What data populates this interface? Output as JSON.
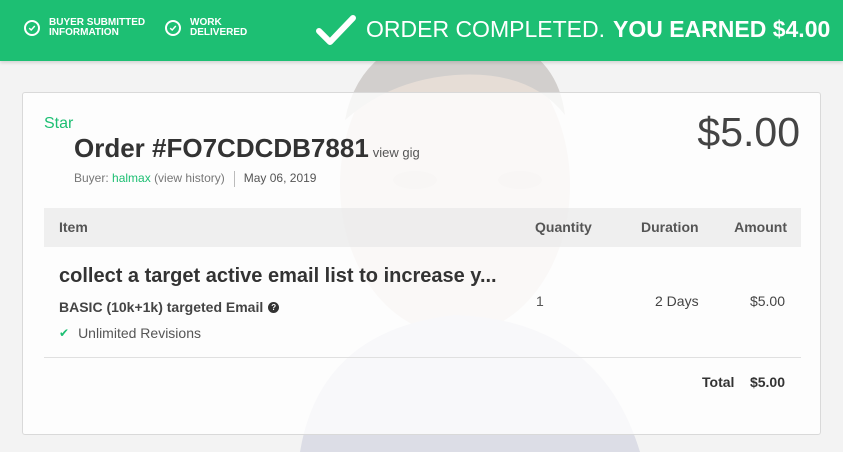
{
  "header": {
    "steps": [
      {
        "line1": "BUYER SUBMITTED",
        "line2": "INFORMATION"
      },
      {
        "line1": "WORK",
        "line2": "DELIVERED"
      }
    ],
    "status_text": "ORDER COMPLETED.",
    "earned_text": "YOU EARNED $4.00"
  },
  "order": {
    "gig_title": "Star",
    "number": "Order #FO7CDCDB7881",
    "view_gig": "view gig",
    "buyer_prefix": "Buyer: ",
    "buyer_name": "halmax",
    "view_history": "(view history)",
    "date": "May 06, 2019",
    "price": "$5.00"
  },
  "table": {
    "headers": {
      "item": "Item",
      "quantity": "Quantity",
      "duration": "Duration",
      "amount": "Amount"
    },
    "row": {
      "title": "collect a target active email list to increase y...",
      "package": "BASIC (10k+1k) targeted Email",
      "feature": "Unlimited Revisions",
      "quantity": "1",
      "duration": "2 Days",
      "amount": "$5.00"
    },
    "total_label": "Total",
    "total_value": "$5.00"
  },
  "colors": {
    "accent": "#1dbf73"
  },
  "icons": [
    "check-circle-icon",
    "big-check-icon",
    "help-icon",
    "check-icon"
  ]
}
